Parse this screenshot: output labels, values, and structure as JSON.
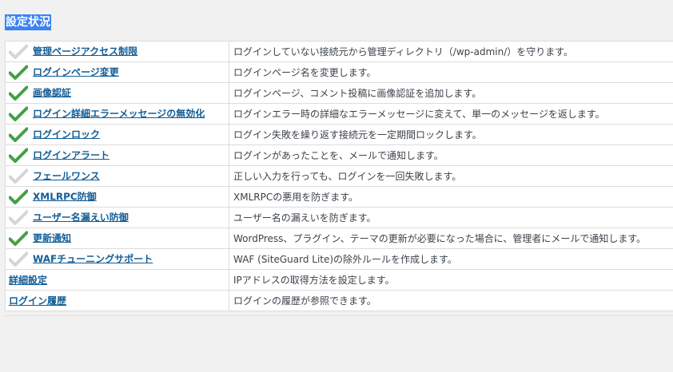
{
  "page": {
    "title": "設定状況"
  },
  "colors": {
    "active_check": "#43a047",
    "inactive_check": "#d5d5d5",
    "link": "#135e96",
    "title_highlight": "#3b82f6"
  },
  "features": [
    {
      "name": "管理ページアクセス制限",
      "description": "ログインしていない接続元から管理ディレクトリ（/wp-admin/）を守ります。",
      "status": "inactive",
      "icon": "check-icon"
    },
    {
      "name": "ログインページ変更",
      "description": "ログインページ名を変更します。",
      "status": "active",
      "icon": "check-icon"
    },
    {
      "name": "画像認証",
      "description": "ログインページ、コメント投稿に画像認証を追加します。",
      "status": "active",
      "icon": "check-icon"
    },
    {
      "name": "ログイン詳細エラーメッセージの無効化",
      "description": "ログインエラー時の詳細なエラーメッセージに変えて、単一のメッセージを返します。",
      "status": "active",
      "icon": "check-icon"
    },
    {
      "name": "ログインロック",
      "description": "ログイン失敗を繰り返す接続元を一定期間ロックします。",
      "status": "active",
      "icon": "check-icon"
    },
    {
      "name": "ログインアラート",
      "description": "ログインがあったことを、メールで通知します。",
      "status": "active",
      "icon": "check-icon"
    },
    {
      "name": "フェールワンス",
      "description": "正しい入力を行っても、ログインを一回失敗します。",
      "status": "inactive",
      "icon": "check-icon"
    },
    {
      "name": "XMLRPC防御",
      "description": "XMLRPCの悪用を防ぎます。",
      "status": "active",
      "icon": "check-icon"
    },
    {
      "name": "ユーザー名漏えい防御",
      "description": "ユーザー名の漏えいを防ぎます。",
      "status": "inactive",
      "icon": "check-icon"
    },
    {
      "name": "更新通知",
      "description": "WordPress、プラグイン、テーマの更新が必要になった場合に、管理者にメールで通知します。",
      "status": "active",
      "icon": "check-icon"
    },
    {
      "name": "WAFチューニングサポート",
      "description": "WAF (SiteGuard Lite)の除外ルールを作成します。",
      "status": "inactive",
      "icon": "check-icon"
    }
  ],
  "settings_links": [
    {
      "name": "詳細設定",
      "description": "IPアドレスの取得方法を設定します。"
    },
    {
      "name": "ログイン履歴",
      "description": "ログインの履歴が参照できます。"
    }
  ]
}
